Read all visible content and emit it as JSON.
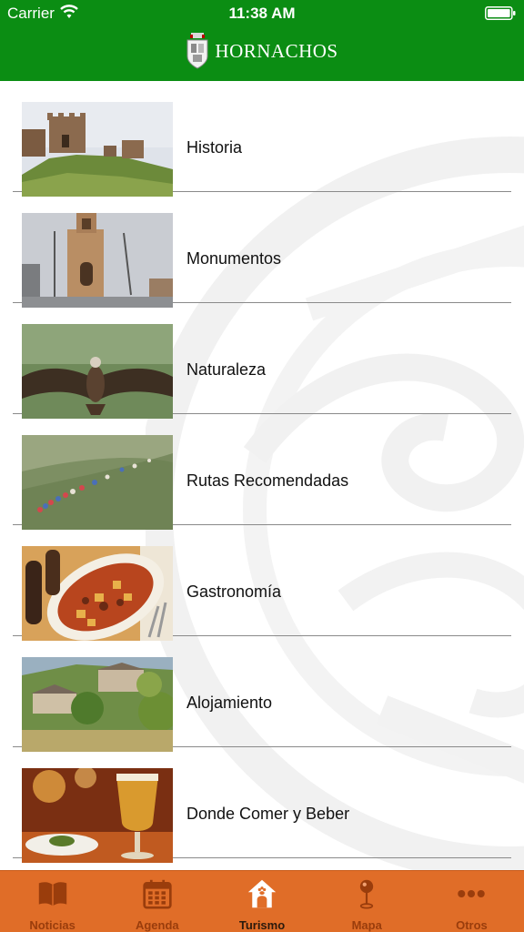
{
  "status_bar": {
    "carrier": "Carrier",
    "time": "11:38 AM"
  },
  "header": {
    "title": "HORNACHOS",
    "brand_color": "#0b8d13"
  },
  "list": {
    "items": [
      {
        "label": "Historia",
        "image": "castle-ruins-photo"
      },
      {
        "label": "Monumentos",
        "image": "church-tower-photo"
      },
      {
        "label": "Naturaleza",
        "image": "vulture-photo"
      },
      {
        "label": "Rutas Recomendadas",
        "image": "hikers-photo"
      },
      {
        "label": "Gastronomía",
        "image": "stew-dish-photo"
      },
      {
        "label": "Alojamiento",
        "image": "rural-houses-photo"
      },
      {
        "label": "Donde Comer y Beber",
        "image": "beer-glass-photo"
      }
    ]
  },
  "tabbar": {
    "bg_color": "#e06d28",
    "active": "Turismo",
    "tabs": [
      {
        "label": "Noticias",
        "icon": "book-icon"
      },
      {
        "label": "Agenda",
        "icon": "calendar-icon"
      },
      {
        "label": "Turismo",
        "icon": "home-icon"
      },
      {
        "label": "Mapa",
        "icon": "map-pin-icon"
      },
      {
        "label": "Otros",
        "icon": "more-dots-icon"
      }
    ]
  }
}
